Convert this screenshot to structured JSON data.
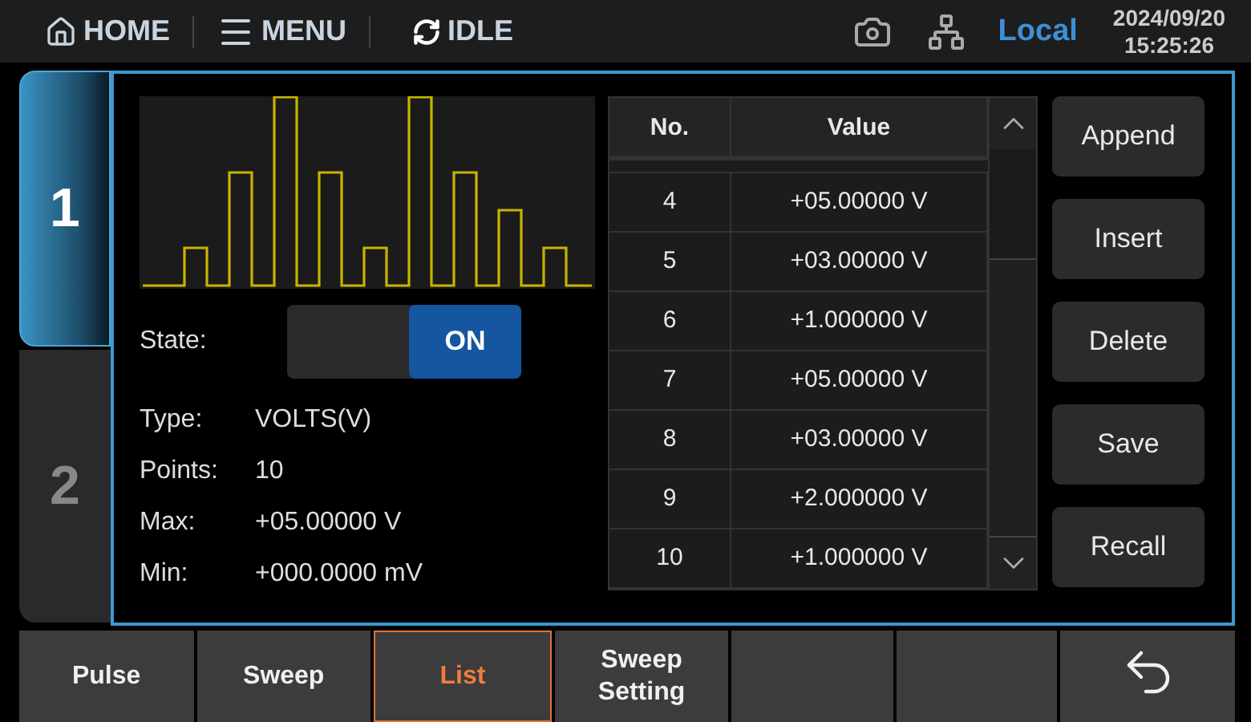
{
  "status_bar": {
    "home": "HOME",
    "menu": "MENU",
    "run_state": "IDLE",
    "mode": "Local",
    "date": "2024/09/20",
    "time": "15:25:26"
  },
  "channel_tabs": [
    {
      "label": "1",
      "selected": true
    },
    {
      "label": "2",
      "selected": false
    }
  ],
  "state": {
    "label": "State:",
    "value": "ON",
    "on": true
  },
  "info": [
    {
      "label": "Type:",
      "value": "VOLTS(V)"
    },
    {
      "label": "Points:",
      "value": "10"
    },
    {
      "label": "Max:",
      "value": "+05.00000 V"
    },
    {
      "label": "Min:",
      "value": "+000.0000 mV"
    }
  ],
  "table": {
    "columns": [
      "No.",
      "Value"
    ],
    "rows": [
      [
        "4",
        "+05.00000 V"
      ],
      [
        "5",
        "+03.00000 V"
      ],
      [
        "6",
        "+1.000000 V"
      ],
      [
        "7",
        "+05.00000 V"
      ],
      [
        "8",
        "+03.00000 V"
      ],
      [
        "9",
        "+2.000000 V"
      ],
      [
        "10",
        "+1.000000 V"
      ]
    ]
  },
  "actions": [
    "Append",
    "Insert",
    "Delete",
    "Save",
    "Recall"
  ],
  "softkeys": [
    {
      "kind": "text",
      "label": "Pulse",
      "selected": false
    },
    {
      "kind": "text",
      "label": "Sweep",
      "selected": false
    },
    {
      "kind": "text",
      "label": "List",
      "selected": true
    },
    {
      "kind": "text",
      "label": "Sweep Setting",
      "selected": false
    },
    {
      "kind": "empty"
    },
    {
      "kind": "empty"
    },
    {
      "kind": "back"
    }
  ]
}
